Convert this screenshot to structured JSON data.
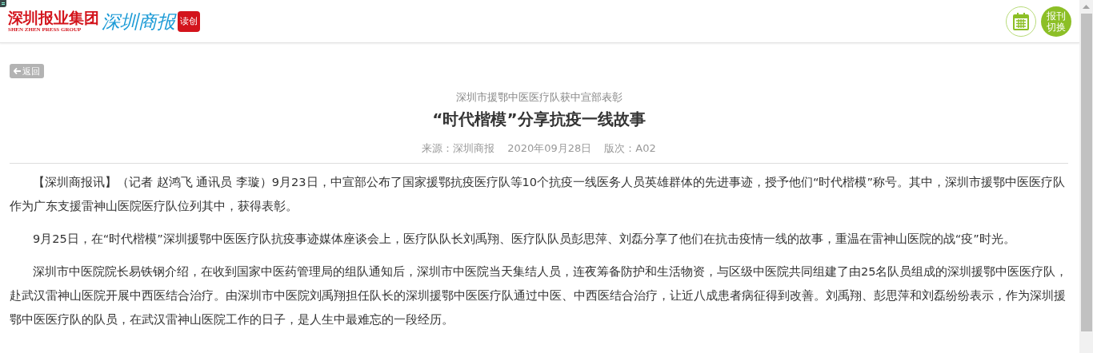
{
  "header": {
    "group_name": "深圳报业集团",
    "group_name_en": "SHEN ZHEN PRESS GROUP",
    "paper_name": "深圳商报",
    "badge": "读创",
    "switch_button": "报刊切换"
  },
  "back_button": "返回",
  "article": {
    "kicker": "深圳市援鄂中医医疗队获中宣部表彰",
    "title": "“时代楷模”分享抗疫一线故事",
    "meta": [
      "来源：深圳商报",
      "2020年09月28日",
      "版次：A02"
    ],
    "paragraphs": [
      "【深圳商报讯】（记者 赵鸿飞 通讯员 李璇）9月23日，中宣部公布了国家援鄂抗疫医疗队等10个抗疫一线医务人员英雄群体的先进事迹，授予他们“时代楷模”称号。其中，深圳市援鄂中医医疗队作为广东支援雷神山医院医疗队位列其中，获得表彰。",
      "9月25日，在“时代楷模”深圳援鄂中医医疗队抗疫事迹媒体座谈会上，医疗队队长刘禹翔、医疗队队员彭思萍、刘磊分享了他们在抗击疫情一线的故事，重温在雷神山医院的战“疫”时光。",
      "深圳市中医院院长易铁钢介绍，在收到国家中医药管理局的组队通知后，深圳市中医院当天集结人员，连夜筹备防护和生活物资，与区级中医院共同组建了由25名队员组成的深圳援鄂中医医疗队，赴武汉雷神山医院开展中西医结合治疗。由深圳市中医院刘禹翔担任队长的深圳援鄂中医医疗队通过中医、中西医结合治疗，让近八成患者病征得到改善。刘禹翔、彭思萍和刘磊纷纷表示，作为深圳援鄂中医医疗队的队员，在武汉雷神山医院工作的日子，是人生中最难忘的一段经历。"
    ]
  }
}
